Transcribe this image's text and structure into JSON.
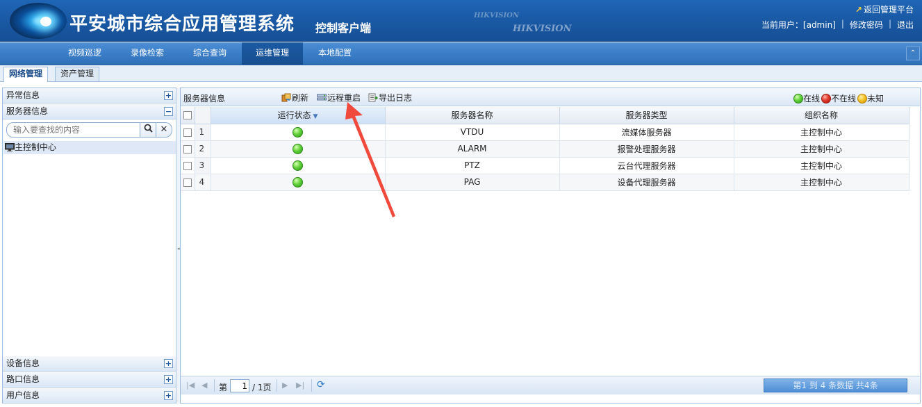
{
  "header": {
    "app_title": "平安城市综合应用管理系统",
    "app_subtitle": "控制客户端",
    "brand_watermark_1": "HIKVISION",
    "brand_watermark_2": "HIKVISION",
    "return_link": "返回管理平台",
    "current_user": "当前用户：[admin]",
    "change_password": "修改密码",
    "logout": "退出"
  },
  "nav": {
    "items": [
      {
        "label": "视频巡逻"
      },
      {
        "label": "录像检索"
      },
      {
        "label": "综合查询"
      },
      {
        "label": "运维管理",
        "active": true
      },
      {
        "label": "本地配置"
      }
    ]
  },
  "subtabs": [
    {
      "label": "网络管理",
      "active": true
    },
    {
      "label": "资产管理"
    }
  ],
  "left_panel": {
    "sections": [
      {
        "label": "异常信息",
        "toggle": "+"
      },
      {
        "label": "服务器信息",
        "toggle": "−"
      },
      {
        "label": "设备信息",
        "toggle": "+"
      },
      {
        "label": "路口信息",
        "toggle": "+"
      },
      {
        "label": "用户信息",
        "toggle": "+"
      }
    ],
    "search_placeholder": "输入要查找的内容",
    "tree_node": "主控制中心"
  },
  "main": {
    "title": "服务器信息",
    "toolbar": {
      "refresh": "刷新",
      "remote_restart": "远程重启",
      "export_log": "导出日志"
    },
    "legend": {
      "online": "在线",
      "offline": "不在线",
      "unknown": "未知"
    },
    "columns": [
      "运行状态",
      "服务器名称",
      "服务器类型",
      "组织名称"
    ],
    "rows": [
      {
        "no": "1",
        "status": "online",
        "name": "VTDU",
        "type": "流媒体服务器",
        "org": "主控制中心"
      },
      {
        "no": "2",
        "status": "online",
        "name": "ALARM",
        "type": "报警处理服务器",
        "org": "主控制中心"
      },
      {
        "no": "3",
        "status": "online",
        "name": "PTZ",
        "type": "云台代理服务器",
        "org": "主控制中心"
      },
      {
        "no": "4",
        "status": "online",
        "name": "PAG",
        "type": "设备代理服务器",
        "org": "主控制中心"
      }
    ],
    "pager": {
      "page_prefix": "第",
      "page_value": "1",
      "page_suffix": "/ 1页",
      "info": "第1 到 4 条数据 共4条"
    }
  },
  "colors": {
    "header_blue": "#1a5aa6",
    "nav_blue": "#3b7ec8",
    "online": "#3fb51f",
    "offline": "#d0291c",
    "unknown": "#f2b418",
    "annotation_arrow": "#f04a3c"
  }
}
